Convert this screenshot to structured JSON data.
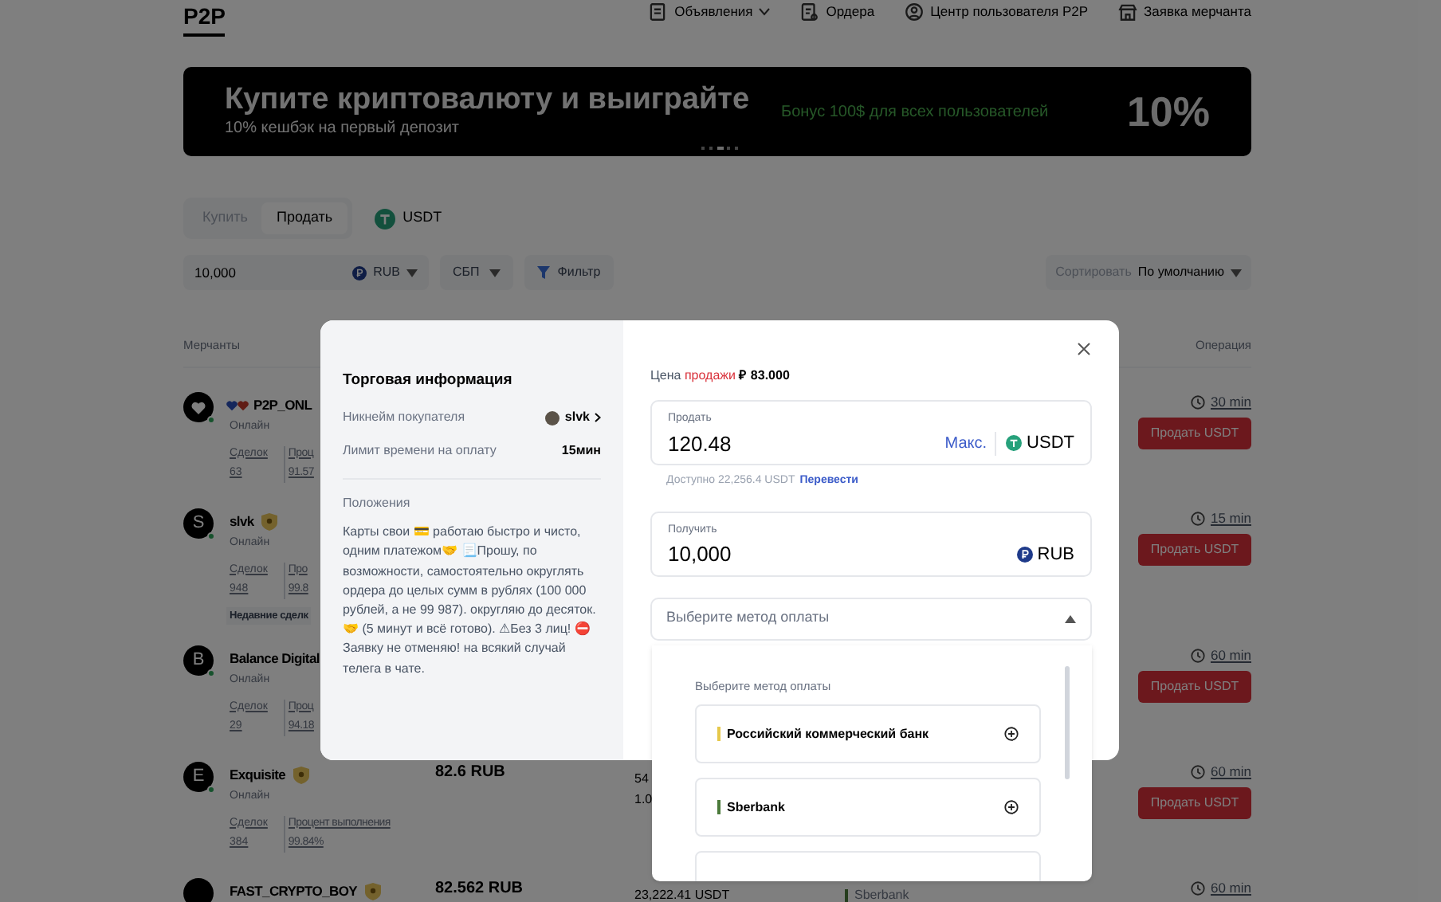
{
  "header": {
    "logo": "P2P",
    "nav": [
      {
        "label": "Объявления",
        "dropdown": true
      },
      {
        "label": "Ордера",
        "dropdown": false
      },
      {
        "label": "Центр пользователя P2P",
        "dropdown": false
      },
      {
        "label": "Заявка мерчанта",
        "dropdown": false
      }
    ]
  },
  "banner": {
    "title": "Купите криптовалюту и выиграйте",
    "subtitle": "10% кешбэк на первый депозит",
    "bonus": "Бонус 100$ для всех пользователей",
    "badge": "10%"
  },
  "side_tabs": [
    {
      "label": "Купить",
      "selected": false
    },
    {
      "label": "Продать",
      "selected": true
    }
  ],
  "coin": "USDT",
  "filters": {
    "amount": "10,000",
    "currency": "RUB",
    "method": "СБП",
    "filter": "Фильтр",
    "sort_label": "Сортировать",
    "sort_value": "По умолчанию"
  },
  "table": {
    "columns": [
      "Мерчанты",
      "Операция"
    ],
    "rows": [
      {
        "hearts": true,
        "verified": false,
        "name": "P2P_ONL",
        "status": "Онлайн",
        "deals_label": "Сделок",
        "deals": "63",
        "rate_label": "Проц",
        "rate": "91.57",
        "time": "30 min",
        "action": "Продать USDT"
      },
      {
        "avatar": "S",
        "hearts": false,
        "verified": true,
        "name": "slvk",
        "status": "Онлайн",
        "deals_label": "Сделок",
        "deals": "948",
        "rate_label": "Про",
        "rate": "99.8",
        "tag": "Недавние сделк",
        "time": "15 min",
        "action": "Продать USDT"
      },
      {
        "avatar": "B",
        "hearts": false,
        "verified": false,
        "name": "Balance Digital",
        "status": "Онлайн",
        "deals_label": "Сделок",
        "deals": "29",
        "rate_label": "Проц",
        "rate": "94.18",
        "time": "60 min",
        "action": "Продать USDT"
      },
      {
        "avatar": "E",
        "hearts": false,
        "verified": true,
        "name": "Exquisite",
        "status": "Онлайн",
        "deals_label": "Сделок",
        "deals": "384",
        "rate_label": "Процент выполнения",
        "rate": "99.84%",
        "price": "82.6 RUB",
        "amount": "54",
        "limit": "1.0",
        "time": "60 min",
        "action": "Продать USDT"
      },
      {
        "hearts": false,
        "verified": true,
        "name": "FAST_CRYPTO_BOY",
        "price": "82.562 RUB",
        "amount": "23,222.41 USDT",
        "payment": "Sberbank",
        "time": "60 min"
      }
    ]
  },
  "modal": {
    "info_title": "Торговая информация",
    "fields": [
      {
        "label": "Никнейм покупателя",
        "value": "slvk",
        "kind": "user"
      },
      {
        "label": "Лимит времени на оплату",
        "value": "15мин",
        "kind": "text"
      }
    ],
    "terms_title": "Положения",
    "terms": "Карты свои 💳 работаю быстро и чисто, одним платежом🤝 📃Прошу, по возможности, самостоятельно округлять ордера до целых сумм в рублях (100 000 рублей, а не 99 987). округляю до десяток. 🤝 (5 минут и всё готово). ⚠Без 3 лиц! ⛔Заявку не отменяю! на всякий случай телега в чате.",
    "price_label": "Цена",
    "price_side": "продажи",
    "price": "₽ 83.000",
    "sell": {
      "label": "Продать",
      "value": "120.48",
      "max": "Макс.",
      "currency": "USDT"
    },
    "available": "Доступно 22,256.4 USDT",
    "transfer": "Перевести",
    "receive": {
      "label": "Получить",
      "value": "10,000",
      "currency": "RUB"
    },
    "payment_select": {
      "placeholder": "Выберите метод оплаты",
      "expanded": true
    },
    "payment_list": {
      "title": "Выберите метод оплаты",
      "items": [
        {
          "name": "Российский коммерческий банк",
          "color": "#e6c84a"
        },
        {
          "name": "Sberbank",
          "color": "#4b7a3a"
        }
      ]
    }
  }
}
